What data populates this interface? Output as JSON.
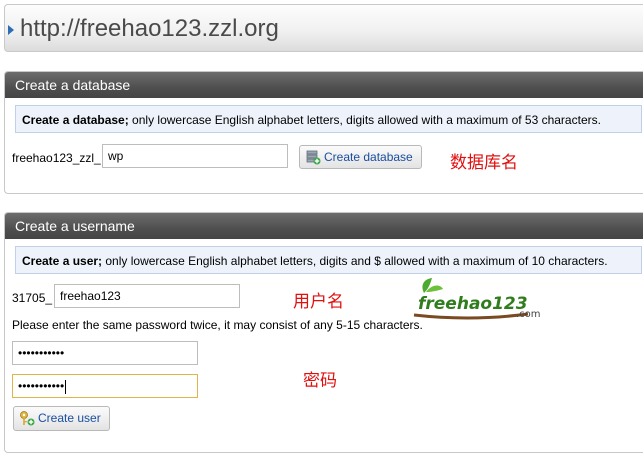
{
  "url_bar": {
    "url": "http://freehao123.zzl.org"
  },
  "database_section": {
    "title": "Create a database",
    "notice_bold": "Create a database;",
    "notice_text": " only lowercase English alphabet letters, digits allowed with a maximum of 53 characters.",
    "prefix": "freehao123_zzl_",
    "db_name_value": "wp",
    "button_label": "Create database",
    "annotation": "数据库名"
  },
  "user_section": {
    "title": "Create a username",
    "notice_bold": "Create a user;",
    "notice_text": " only lowercase English alphabet letters, digits and $ allowed with a maximum of 10 characters.",
    "prefix": "31705_",
    "username_value": "freehao123",
    "username_annotation": "用户名",
    "password_hint": "Please enter the same password twice, it may consist of any 5-15 characters.",
    "password_value": "•••••••••••",
    "password_confirm_value": "•••••••••••",
    "password_annotation": "密码",
    "button_label": "Create user"
  },
  "watermark": {
    "text": "freehao123",
    "suffix": ".com"
  }
}
